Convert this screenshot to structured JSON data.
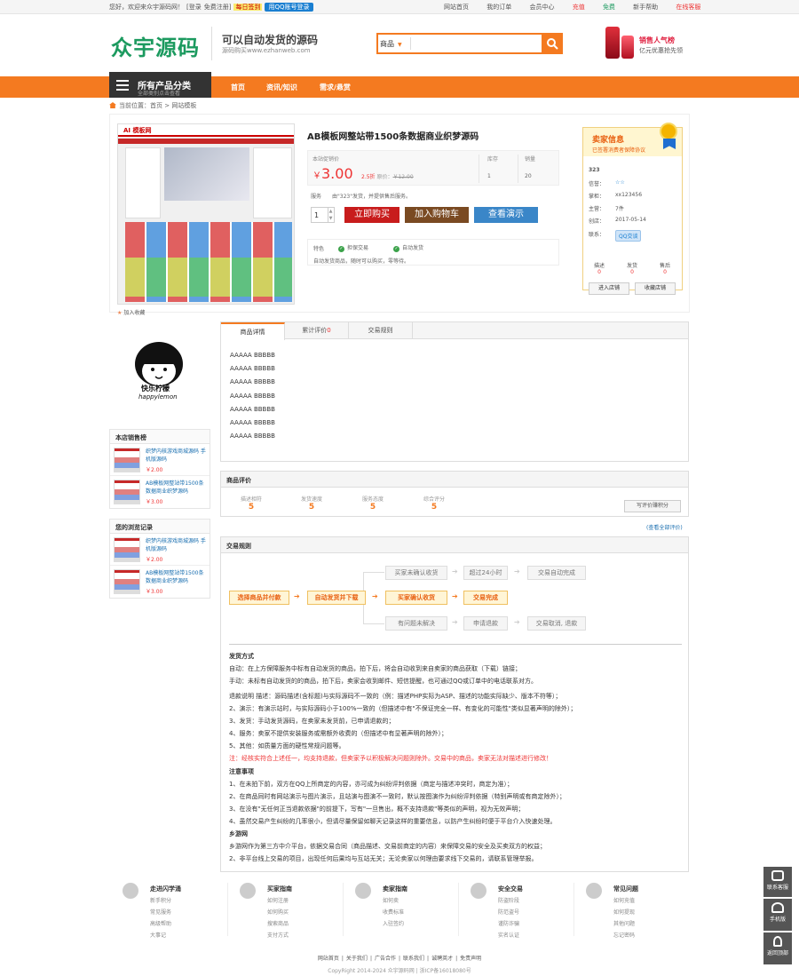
{
  "topbar": {
    "welcome": "您好，欢迎来众宇源码网！",
    "login": "[登录",
    "register": "免费注册]",
    "daily": "每日签到",
    "qq_login": "用QQ账号登录",
    "links": [
      "网站首页",
      "我的订单",
      "会员中心",
      "充值",
      "免费",
      "新手帮助",
      "在线客服"
    ]
  },
  "header": {
    "logo": "众宇源码",
    "slogan": "可以自动发货的源码",
    "slogan_sub": "源码购买www.ezhanweb.com",
    "search_category": "商品",
    "search_placeholder": "",
    "ad_title": "销售人气榜",
    "ad_sub": "亿元优惠抢先领"
  },
  "nav": {
    "cat_title": "所有产品分类",
    "cat_sub": "全部类别点击查看",
    "items": [
      "首页",
      "资讯/知识",
      "需求/悬赏"
    ]
  },
  "breadcrumb": {
    "text": "当前位置：首页 > 网站模板"
  },
  "product": {
    "image_label": "AI 模板网",
    "title": "AB模板网整站带1500条数据商业织梦源码",
    "price_label": "本站促销价",
    "price": "3.00",
    "currency": "￥",
    "discount": "2.5折",
    "original_label": "原价：",
    "original_price": "￥12.00",
    "stock_label": "库存",
    "stock": "1",
    "sales_label": "销量",
    "sales": "20",
    "service_label": "服务",
    "service_text": "由\"323\"发货，并提供售后服务。",
    "quantity": "1",
    "buy_label": "立即购买",
    "cart_label": "加入购物车",
    "demo_label": "查看演示",
    "feature_label": "特色",
    "feature_1": "担保交易",
    "feature_2": "自动发货",
    "feature_note": "自动发货商品，随时可以购买，零等待。",
    "favorite": "加入收藏"
  },
  "seller": {
    "title": "卖家信息",
    "subtitle": "已签署消费者保障协议",
    "name": "323",
    "rating_label": "信誉：",
    "rating": "☆☆",
    "qq_label": "掌柜：",
    "qq_value": "xx123456",
    "level_label": "主营：",
    "level_value": "7件",
    "date_label": "创店：",
    "date_value": "2017-05-14",
    "contact_label": "联系：",
    "contact_btn": "QQ交谈",
    "stats": [
      {
        "label": "描述",
        "value": "0"
      },
      {
        "label": "发货",
        "value": "0"
      },
      {
        "label": "售后",
        "value": "0"
      }
    ],
    "enter_shop": "进入店铺",
    "collect_shop": "收藏店铺"
  },
  "shop": {
    "logo_text": "快乐柠檬",
    "logo_en": "happylemon"
  },
  "hot": {
    "title": "本店销售榜",
    "items": [
      {
        "name": "织梦内核游戏商城源码 手机版源码",
        "price": "￥2.00"
      },
      {
        "name": "AB模板网整站带1500条数据商业织梦源码",
        "price": "￥3.00"
      }
    ]
  },
  "history": {
    "title": "您的浏览记录",
    "items": [
      {
        "name": "织梦内核游戏商城源码 手机版源码",
        "price": "￥2.00"
      },
      {
        "name": "AB模板网整站带1500条数据商业织梦源码",
        "price": "￥3.00"
      }
    ]
  },
  "tabs": {
    "detail": "商品详情",
    "reviews": "累计评价",
    "reviews_count": "0",
    "rules": "交易规则"
  },
  "detail_lines": [
    "AAAAA BBBBB",
    "AAAAA BBBBB",
    "AAAAA BBBBB",
    "AAAAA BBBBB",
    "AAAAA BBBBB",
    "AAAAA BBBBB",
    "AAAAA BBBBB"
  ],
  "review": {
    "title": "商品评价",
    "items": [
      {
        "label": "描述相符",
        "value": "5"
      },
      {
        "label": "发货速度",
        "value": "5"
      },
      {
        "label": "服务态度",
        "value": "5"
      },
      {
        "label": "综合评分",
        "value": "5"
      }
    ],
    "write_btn": "写评价赚积分",
    "all_link": "(查看全部评价)"
  },
  "rules": {
    "title": "交易规则",
    "flow": {
      "s1": "选择商品并付款",
      "s2": "自动发货并下载",
      "s3": "买家确认收货",
      "s4": "交易完成",
      "t1": "买家未确认收货",
      "t2": "超过24小时",
      "t3": "交易自动完成",
      "b1": "有问题未解决",
      "b2": "申请退款",
      "b3": "交易取消, 退款"
    },
    "lines": [
      {
        "t": "发货方式",
        "c": "b"
      },
      {
        "t": "自动：在上方保障服务中标有自动发货的商品，拍下后，将会自动收到来自卖家的商品获取（下载）链接；",
        "c": ""
      },
      {
        "t": "手动：未标有自动发货的的商品，拍下后，卖家会收到邮件、短信提醒，也可通过QQ或订单中的电话联系对方。",
        "c": ""
      },
      {
        "t": "退款说明 描述：源码描述(含标题)与实际源码不一致的（例：描述PHP实际为ASP、描述的功能实际缺少、版本不符等）；",
        "c": ""
      },
      {
        "t": "2、演示：有演示站时，与实际源码小于100%一致的（但描述中有\"不保证完全一样、有变化的可能性\"类似显著声明的除外）；",
        "c": ""
      },
      {
        "t": "3、发货：手动发货源码，在卖家未发货前，已申请退款的；",
        "c": ""
      },
      {
        "t": "4、服务：卖家不提供安装服务或需额外收费的（但描述中有显著声明的除外）；",
        "c": ""
      },
      {
        "t": "5、其他：如质量方面的硬性常规问题等。",
        "c": ""
      },
      {
        "t": "注：经核实符合上述任一，均支持退款，但卖家予以积极解决问题则除外。交易中的商品，卖家无法对描述进行修改！",
        "c": "r"
      },
      {
        "t": "注意事项",
        "c": "b"
      },
      {
        "t": "1、在未拍下前，双方在QQ上所商定的内容，亦可成为纠纷评判依据（商定与描述冲突时，商定为准）；",
        "c": ""
      },
      {
        "t": "2、在商品同时有网站演示与图片演示，且站演与图演不一致时，默认按图演作为纠纷评判依据（特别声明或有商定除外）；",
        "c": ""
      },
      {
        "t": "3、在没有\"无任何正当退款依据\"的前提下，写有\"一旦售出，概不支持退款\"等类似的声明，视为无效声明；",
        "c": ""
      },
      {
        "t": "4、虽然交易产生纠纷的几率很小，但请尽量保留如聊天记录这样的重要信息，以防产生纠纷时便于平台介入快速处理。",
        "c": ""
      },
      {
        "t": "乡游网",
        "c": "b"
      },
      {
        "t": "乡游网作为第三方中介平台，依据交易合同（商品描述、交易前商定的内容）来保障交易的安全及买卖双方的权益；",
        "c": ""
      },
      {
        "t": "2、非平台线上交易的项目，出现任何后果均与互站无关；无论卖家以何理由要求线下交易的，请联系管理举报。",
        "c": ""
      }
    ]
  },
  "footer": {
    "cols": [
      {
        "title": "走进闪学涌",
        "items": [
          "新手积分",
          "常见服务",
          "高级帮助",
          "大事记"
        ]
      },
      {
        "title": "买家指南",
        "items": [
          "如何注册",
          "如何购买",
          "搜索商品",
          "支付方式"
        ]
      },
      {
        "title": "卖家指南",
        "items": [
          "如何卖",
          "收费标准",
          "入驻签约"
        ]
      },
      {
        "title": "安全交易",
        "items": [
          "防盗阶段",
          "防范盗号",
          "谨防诈骗",
          "实名认证"
        ]
      },
      {
        "title": "常见问题",
        "items": [
          "如何充值",
          "如何提现",
          "其他问题",
          "忘记密码"
        ]
      }
    ],
    "links": [
      "网站首页",
      "关于我们",
      "广告合作",
      "联系我们",
      "诚聘英才",
      "免责声明"
    ],
    "copyright": "CopyRight 2014-2024 众宇源码网 | 浙ICP备16018080号",
    "float_bar": [
      "联系客服",
      "手机版",
      "返回顶部"
    ]
  }
}
